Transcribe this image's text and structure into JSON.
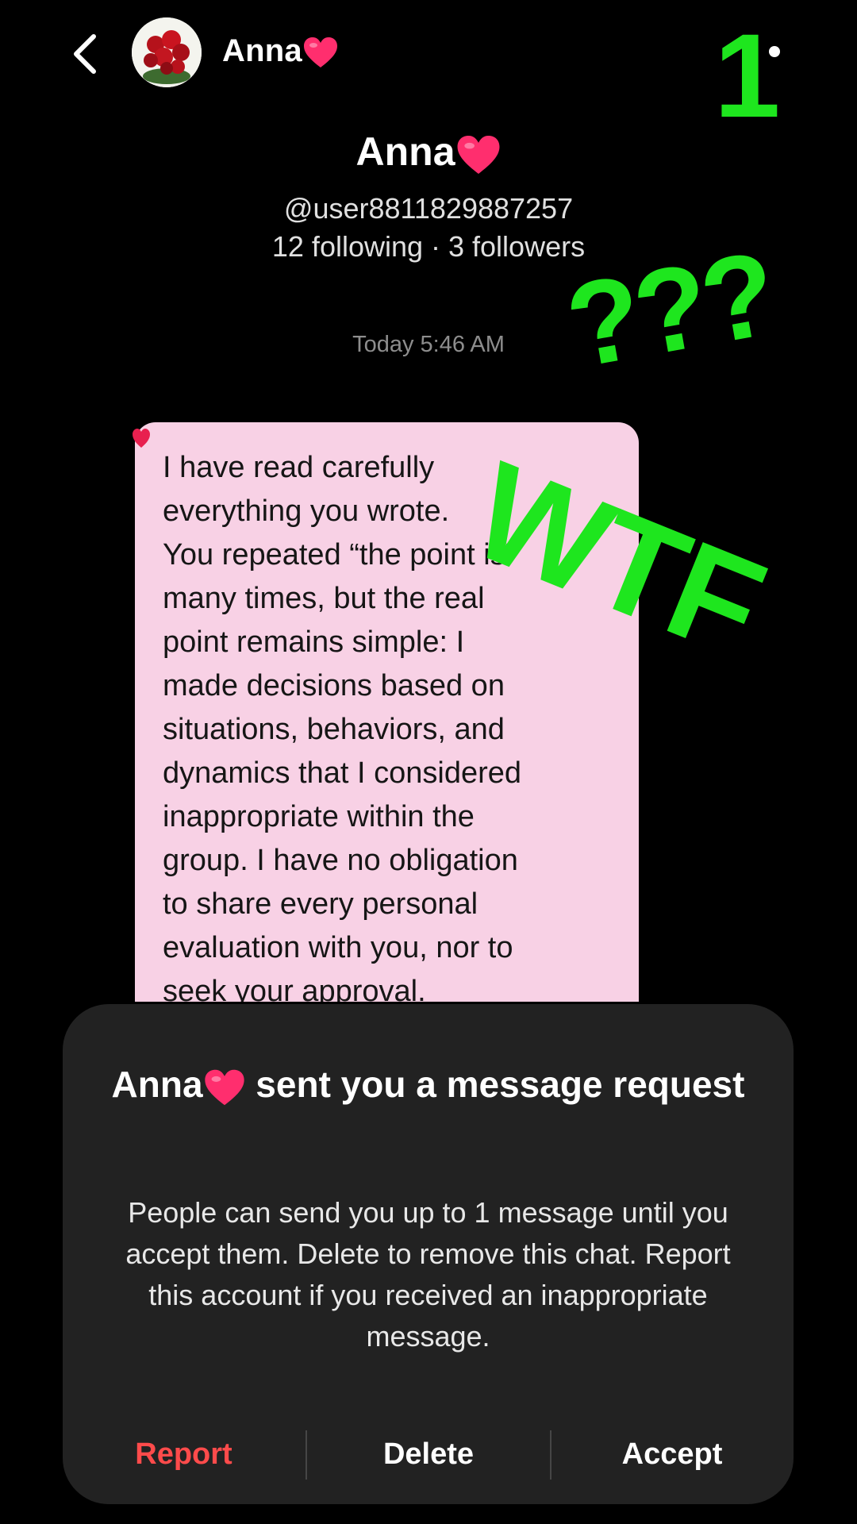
{
  "header": {
    "name": "Anna",
    "back_icon": "chevron-left-icon",
    "more_icon": "more-icon"
  },
  "profile": {
    "name": "Anna",
    "handle": "@user8811829887257",
    "stats": "12 following · 3 followers"
  },
  "chat": {
    "timestamp": "Today 5:46 AM",
    "message": "I have read carefully\neverything you wrote.\nYou repeated “the point is”\nmany times, but the real\npoint remains simple: I\nmade decisions based on\nsituations, behaviors, and\ndynamics that I considered\ninappropriate within the\ngroup. I have no obligation\nto share every personal\nevaluation with you, nor to\nseek your approval."
  },
  "overlays": {
    "one": "1",
    "question": "???",
    "wtf": "WTF"
  },
  "request_sheet": {
    "title_name": "Anna",
    "title_rest": " sent you a message request",
    "body": "People can send you up to 1 message until you accept them. Delete to remove this chat. Report this account if you received an inappropriate message.",
    "report_label": "Report",
    "delete_label": "Delete",
    "accept_label": "Accept"
  },
  "colors": {
    "background": "#000000",
    "bubble": "#f8d1e5",
    "sheet": "#222222",
    "report": "#ff4b4b",
    "overlay_green": "#1ee61e",
    "heart": "#ff2e6e"
  }
}
